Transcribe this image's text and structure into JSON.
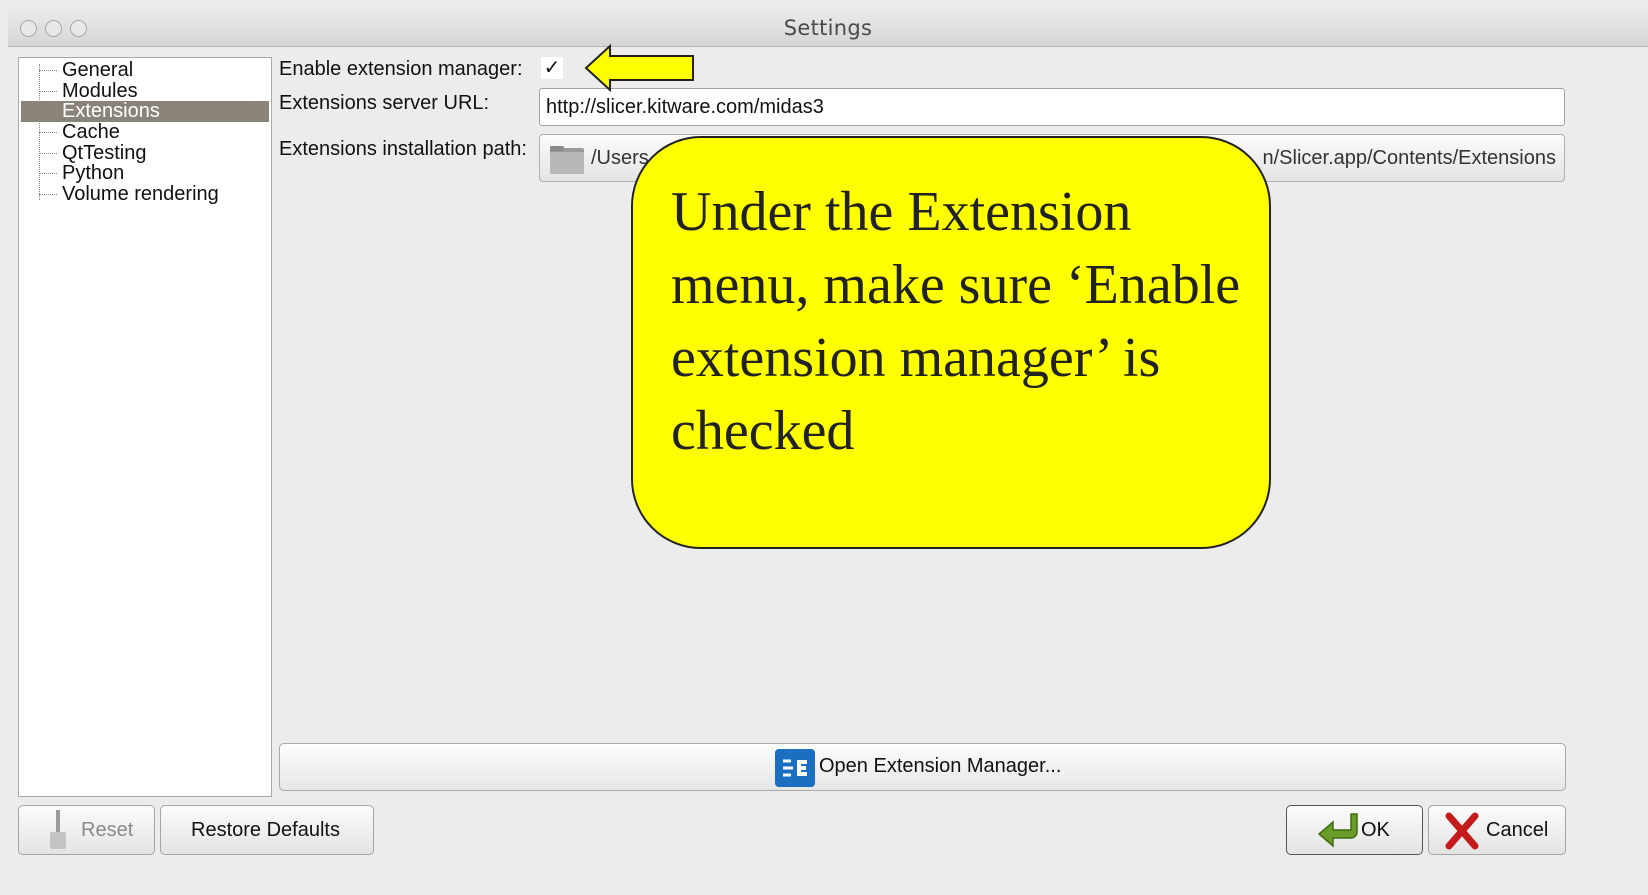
{
  "window": {
    "title": "Settings"
  },
  "sidebar": {
    "items": [
      {
        "label": "General",
        "selected": false
      },
      {
        "label": "Modules",
        "selected": false
      },
      {
        "label": "Extensions",
        "selected": true
      },
      {
        "label": "Cache",
        "selected": false
      },
      {
        "label": "QtTesting",
        "selected": false
      },
      {
        "label": "Python",
        "selected": false
      },
      {
        "label": "Volume rendering",
        "selected": false
      }
    ]
  },
  "extensions": {
    "enable_label": "Enable extension manager:",
    "enable_checked": true,
    "check_glyph": "✓",
    "server_url_label": "Extensions server URL:",
    "server_url_value": "http://slicer.kitware.com/midas3",
    "install_path_label": "Extensions installation path:",
    "install_path_start": "/Users",
    "install_path_end": "n/Slicer.app/Contents/Extensions",
    "open_manager_label": "Open Extension Manager..."
  },
  "callout": {
    "text": "Under the Extension menu, make sure ‘Enable extension manager’ is checked",
    "color": "#ffff00"
  },
  "buttons": {
    "reset": "Reset",
    "restore_defaults": "Restore Defaults",
    "ok": "OK",
    "cancel": "Cancel"
  },
  "colors": {
    "selection": "#8a8478",
    "annotation_yellow": "#ffff00"
  }
}
